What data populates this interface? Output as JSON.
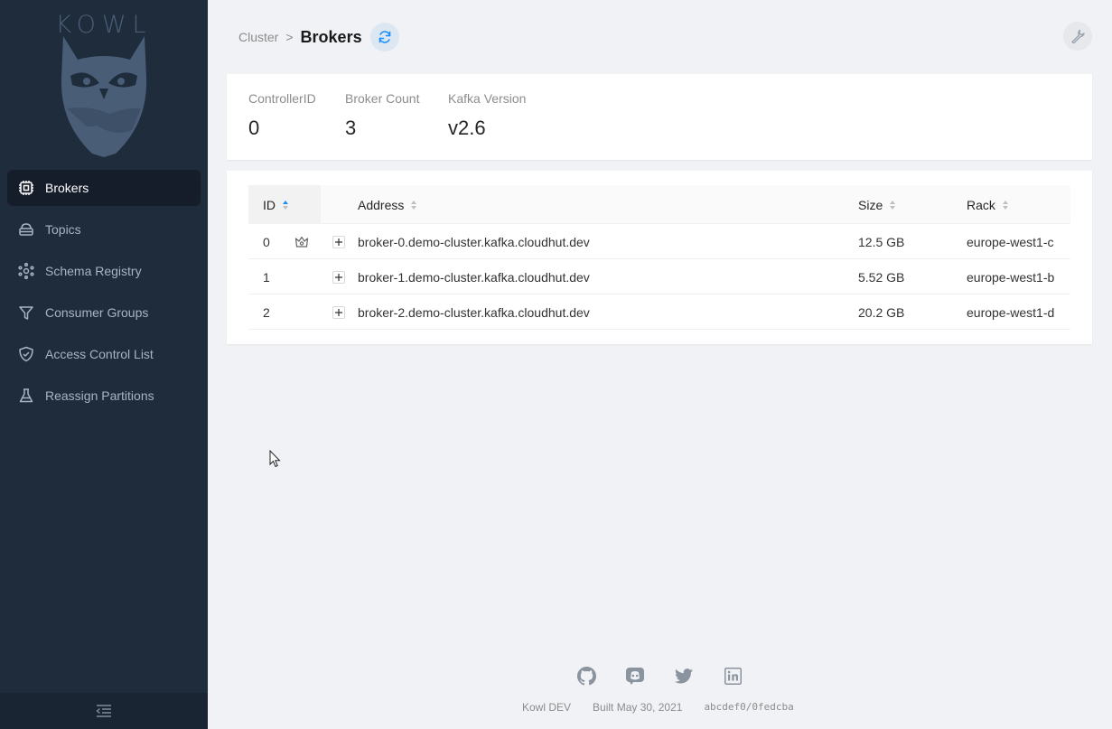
{
  "app": {
    "logo_text": "KOWL"
  },
  "sidebar": {
    "items": [
      {
        "label": "Brokers",
        "icon": "cpu-icon",
        "active": true
      },
      {
        "label": "Topics",
        "icon": "database-icon"
      },
      {
        "label": "Schema Registry",
        "icon": "schema-icon"
      },
      {
        "label": "Consumer Groups",
        "icon": "filter-icon"
      },
      {
        "label": "Access Control List",
        "icon": "shield-check-icon"
      },
      {
        "label": "Reassign Partitions",
        "icon": "beaker-icon"
      }
    ],
    "collapse_icon": "menu-collapse-icon"
  },
  "header": {
    "breadcrumb_parent": "Cluster",
    "breadcrumb_separator": ">",
    "title": "Brokers"
  },
  "stats": {
    "controller_label": "ControllerID",
    "controller_value": "0",
    "broker_count_label": "Broker Count",
    "broker_count_value": "3",
    "kafka_version_label": "Kafka Version",
    "kafka_version_value": "v2.6"
  },
  "table": {
    "columns": {
      "id": "ID",
      "address": "Address",
      "size": "Size",
      "rack": "Rack"
    },
    "rows": [
      {
        "id": "0",
        "controller": true,
        "address": "broker-0.demo-cluster.kafka.cloudhut.dev",
        "size": "12.5 GB",
        "rack": "europe-west1-c"
      },
      {
        "id": "1",
        "controller": false,
        "address": "broker-1.demo-cluster.kafka.cloudhut.dev",
        "size": "5.52 GB",
        "rack": "europe-west1-b"
      },
      {
        "id": "2",
        "controller": false,
        "address": "broker-2.demo-cluster.kafka.cloudhut.dev",
        "size": "20.2 GB",
        "rack": "europe-west1-d"
      }
    ]
  },
  "footer": {
    "icons": [
      "github-icon",
      "discord-icon",
      "twitter-icon",
      "linkedin-icon"
    ],
    "edition": "Kowl DEV",
    "built": "Built May 30, 2021",
    "commit": "abcdef0/0fedcba"
  },
  "colors": {
    "sidebar_bg": "#1f2c3c",
    "sidebar_active": "#141d29",
    "accent": "#1890ff"
  }
}
